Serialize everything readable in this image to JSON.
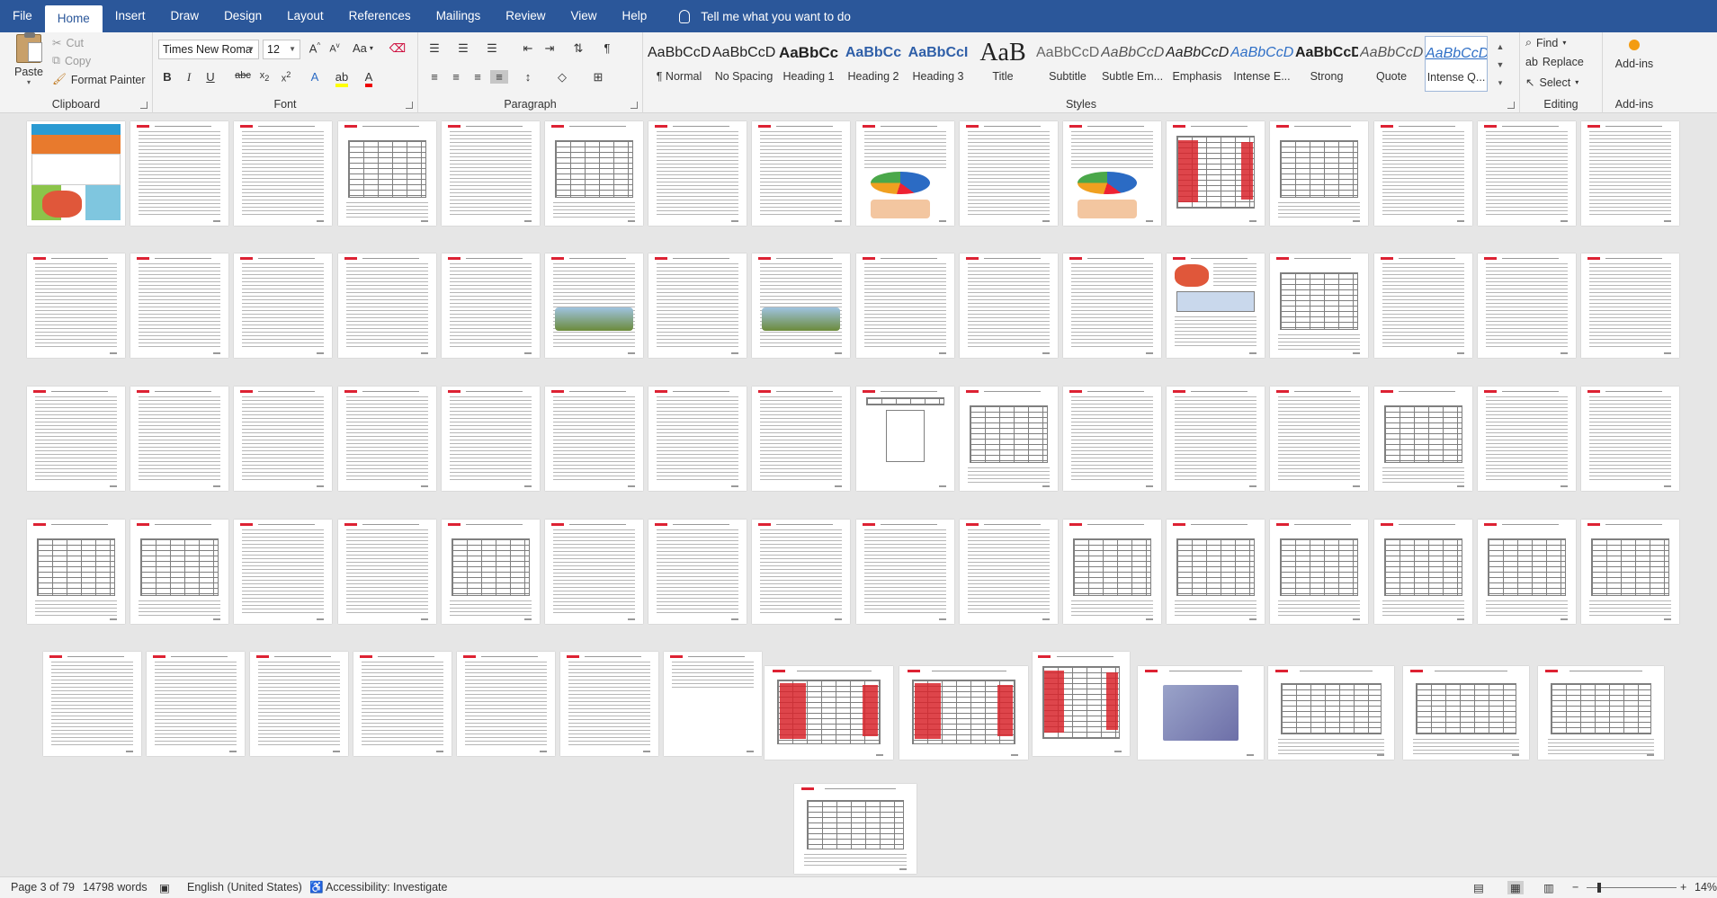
{
  "menu": {
    "tabs": [
      "File",
      "Home",
      "Insert",
      "Draw",
      "Design",
      "Layout",
      "References",
      "Mailings",
      "Review",
      "View",
      "Help"
    ],
    "active": "Home",
    "tell_me": "Tell me what you want to do"
  },
  "ribbon": {
    "clipboard": {
      "label": "Clipboard",
      "paste": "Paste",
      "cut": "Cut",
      "copy": "Copy",
      "format_painter": "Format Painter"
    },
    "font": {
      "label": "Font",
      "font_name": "Times New Roma",
      "font_size": "12",
      "aa": "Aa"
    },
    "paragraph": {
      "label": "Paragraph"
    },
    "styles": {
      "label": "Styles",
      "items": [
        {
          "preview": "AaBbCcDc",
          "name": "¶ Normal"
        },
        {
          "preview": "AaBbCcDc",
          "name": "No Spacing"
        },
        {
          "preview": "AaBbCc",
          "name": "Heading 1"
        },
        {
          "preview": "AaBbCc",
          "name": "Heading 2"
        },
        {
          "preview": "AaBbCcI",
          "name": "Heading 3"
        },
        {
          "preview": "AaB",
          "name": "Title"
        },
        {
          "preview": "AaBbCcD",
          "name": "Subtitle"
        },
        {
          "preview": "AaBbCcDc",
          "name": "Subtle Em..."
        },
        {
          "preview": "AaBbCcDc",
          "name": "Emphasis"
        },
        {
          "preview": "AaBbCcDc",
          "name": "Intense E..."
        },
        {
          "preview": "AaBbCcDc",
          "name": "Strong"
        },
        {
          "preview": "AaBbCcDc",
          "name": "Quote"
        },
        {
          "preview": "AaBbCcDc",
          "name": "Intense Q..."
        }
      ]
    },
    "editing": {
      "label": "Editing",
      "find": "Find",
      "replace": "Replace",
      "select": "Select"
    },
    "addins": {
      "label": "Add-ins",
      "button": "Add-ins"
    }
  },
  "status": {
    "page": "Page 3 of 79",
    "words": "14798 words",
    "language": "English (United States)",
    "accessibility": "Accessibility: Investigate",
    "zoom": "14%"
  },
  "colors": {
    "accent": "#2b579a",
    "highlight_red": "#d8242c"
  }
}
